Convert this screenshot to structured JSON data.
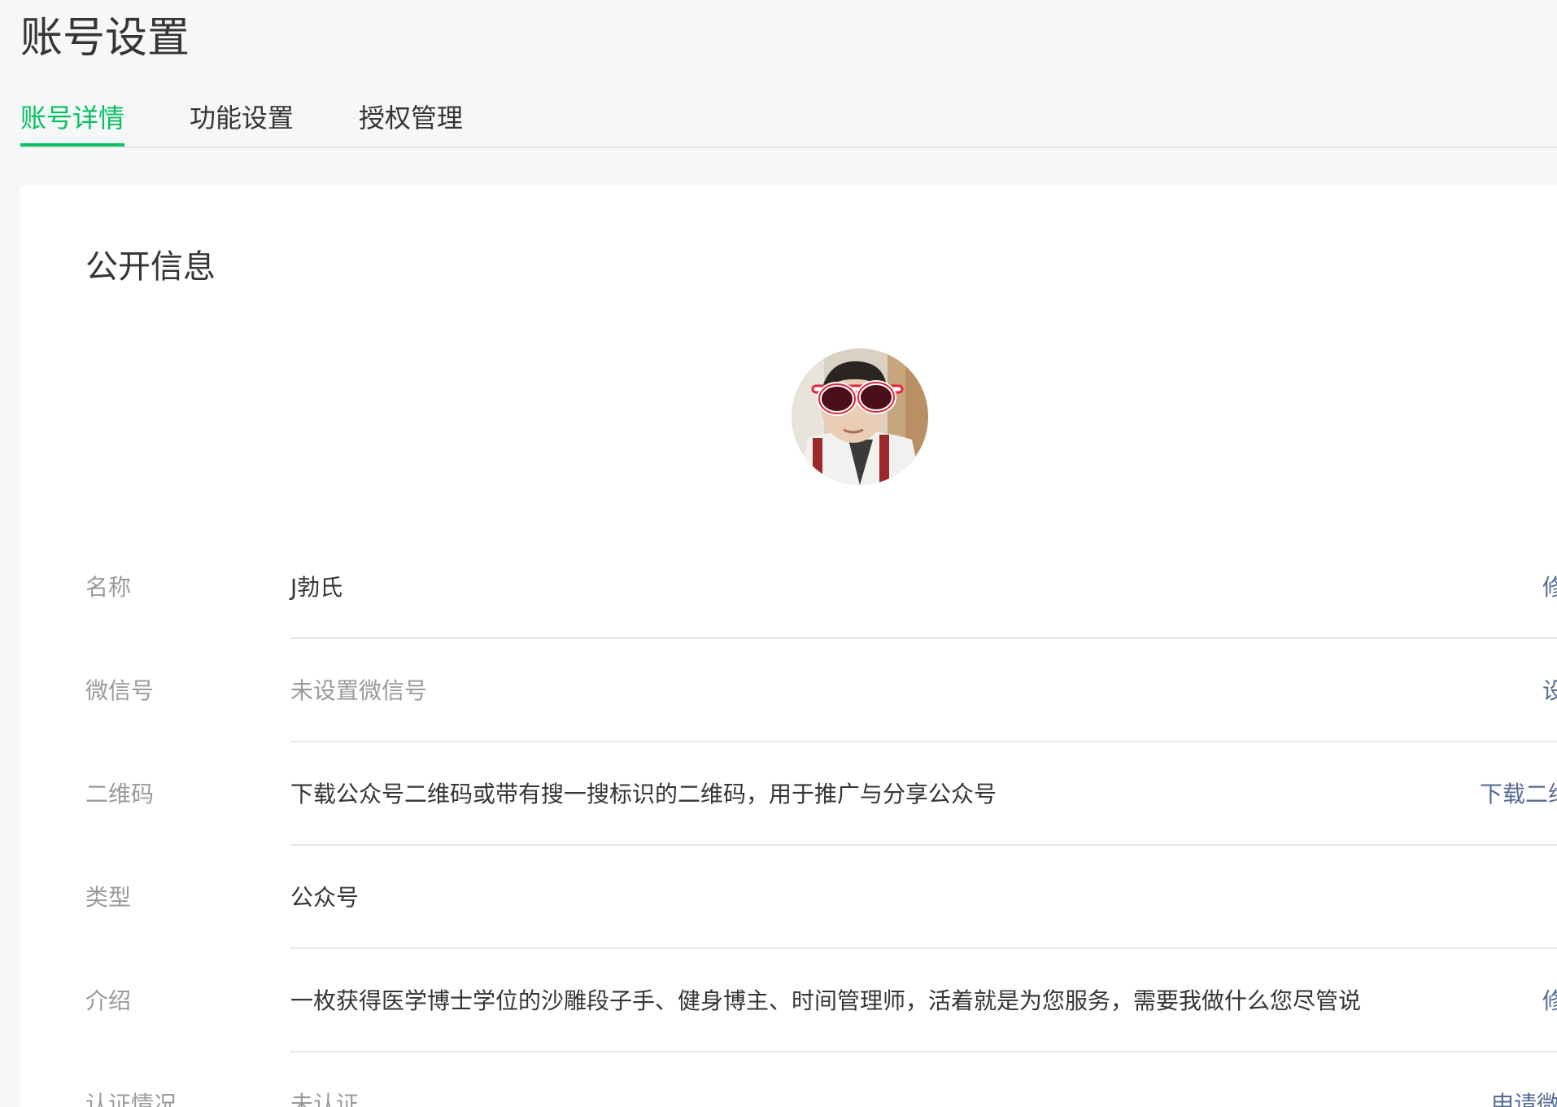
{
  "page": {
    "title": "账号设置"
  },
  "tabs": [
    {
      "label": "账号详情",
      "active": true
    },
    {
      "label": "功能设置",
      "active": false
    },
    {
      "label": "授权管理",
      "active": false
    }
  ],
  "public_info": {
    "title": "公开信息",
    "rows": [
      {
        "label": "名称",
        "value": "J勃氏",
        "value_muted": false,
        "action": "修改"
      },
      {
        "label": "微信号",
        "value": "未设置微信号",
        "value_muted": true,
        "action": "设置"
      },
      {
        "label": "二维码",
        "value": "下载公众号二维码或带有搜一搜标识的二维码，用于推广与分享公众号",
        "value_muted": false,
        "action": "下载二维码"
      },
      {
        "label": "类型",
        "value": "公众号",
        "value_muted": false,
        "action": ""
      },
      {
        "label": "介绍",
        "value": "一枚获得医学博士学位的沙雕段子手、健身博主、时间管理师，活着就是为您服务，需要我做什么您尽管说",
        "value_muted": false,
        "action": "修改"
      },
      {
        "label": "认证情况",
        "value": "未认证",
        "value_muted": true,
        "action": "申请微信认证"
      }
    ]
  },
  "colors": {
    "accent": "#07c160",
    "link": "#576b95",
    "text": "#353535",
    "muted": "#9a9a9a",
    "background": "#f6f7f9"
  }
}
